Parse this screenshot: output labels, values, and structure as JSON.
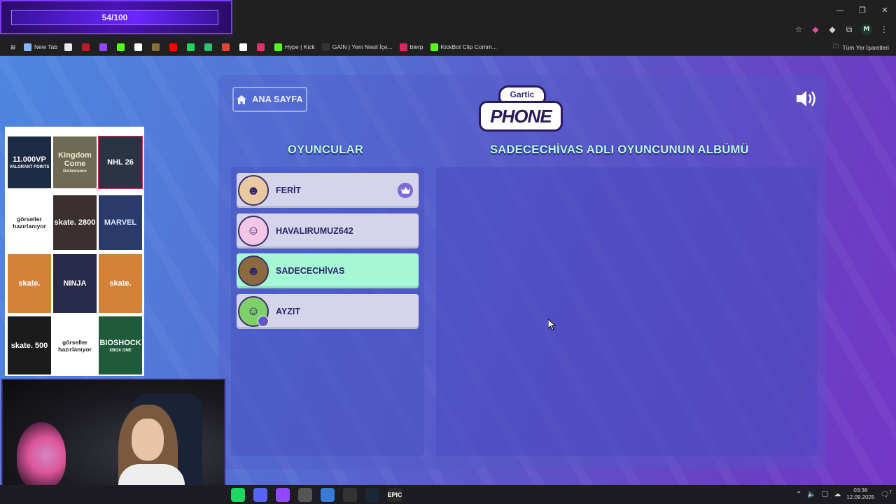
{
  "overlay": {
    "hype_progress": "54/100",
    "hype_fraction": 0.54
  },
  "browser": {
    "window_controls": [
      "—",
      "❐",
      "✕"
    ],
    "profile_initial": "M",
    "bookmarks": [
      {
        "label": "New Tab",
        "icon": "globe-icon",
        "color": "#8ab4f8"
      },
      {
        "label": "",
        "icon": "doc-icon",
        "color": "#e8eaed"
      },
      {
        "label": "",
        "icon": "red-icon",
        "color": "#c0182a"
      },
      {
        "label": "",
        "icon": "twitch-icon",
        "color": "#9146ff"
      },
      {
        "label": "",
        "icon": "kick-icon",
        "color": "#53fc18"
      },
      {
        "label": "",
        "icon": "diamond-icon",
        "color": "#ffffff"
      },
      {
        "label": "",
        "icon": "game-icon",
        "color": "#8a6d3b"
      },
      {
        "label": "",
        "icon": "youtube-icon",
        "color": "#ff0000"
      },
      {
        "label": "",
        "icon": "spotify-icon",
        "color": "#1ed760"
      },
      {
        "label": "",
        "icon": "green-icon",
        "color": "#2fbf71"
      },
      {
        "label": "",
        "icon": "gmail-icon",
        "color": "#ea4335"
      },
      {
        "label": "",
        "icon": "x-icon",
        "color": "#ffffff"
      },
      {
        "label": "",
        "icon": "instagram-icon",
        "color": "#e1306c"
      },
      {
        "label": "Hype | Kick",
        "icon": "kick-icon",
        "color": "#53fc18"
      },
      {
        "label": "GAİN | Yeni Nesil İçe...",
        "icon": "gain-icon",
        "color": "#333333"
      },
      {
        "label": "blerp",
        "icon": "blerp-icon",
        "color": "#e0245e"
      },
      {
        "label": "KickBot Clip Comm...",
        "icon": "kickbot-icon",
        "color": "#53fc18"
      }
    ],
    "all_bookmarks_label": "Tüm Yer İşaretleri"
  },
  "game": {
    "home_label": "ANA SAYFA",
    "logo_top": "Gartic",
    "logo_main": "PHONE",
    "players_title": "OYUNCULAR",
    "album_title": "SADECECHİVAS ADLI OYUNCUNUN ALBÜMÜ",
    "players": [
      {
        "name": "FERİT",
        "avatar_color": "#e9c9a0",
        "emoji": "☻",
        "host": true,
        "active": false,
        "badge": false
      },
      {
        "name": "HAVALIRUMUZ642",
        "avatar_color": "#f3c6e6",
        "emoji": "☺",
        "host": false,
        "active": false,
        "badge": false
      },
      {
        "name": "SADECECHİVAS",
        "avatar_color": "#8a6a3e",
        "emoji": "☻",
        "host": false,
        "active": true,
        "badge": false
      },
      {
        "name": "AYZIT",
        "avatar_color": "#7fd06a",
        "emoji": "☺",
        "host": false,
        "active": false,
        "badge": true
      }
    ]
  },
  "ads": {
    "tiles": [
      {
        "text": "11.000VP",
        "sub": "VALORANT POINTS",
        "bg": "#1d2b44",
        "fg": "#ffffff"
      },
      {
        "text": "Kingdom Come",
        "sub": "Deliverance",
        "bg": "#6d6a55",
        "fg": "#f3ead0"
      },
      {
        "text": "NHL 26",
        "sub": "",
        "bg": "#2b3344",
        "fg": "#ffffff"
      },
      {
        "text": "görseller hazırlanıyor",
        "sub": "",
        "bg": "#ffffff",
        "fg": "#222222"
      },
      {
        "text": "skate. 2800",
        "sub": "",
        "bg": "#3a3030",
        "fg": "#ffffff"
      },
      {
        "text": "MARVEL",
        "sub": "",
        "bg": "#2a3a6a",
        "fg": "#dfe7ff"
      },
      {
        "text": "skate.",
        "sub": "",
        "bg": "#d4823a",
        "fg": "#ffffff"
      },
      {
        "text": "NINJA",
        "sub": "",
        "bg": "#2a2a4a",
        "fg": "#ffffff"
      },
      {
        "text": "skate.",
        "sub": "",
        "bg": "#d4823a",
        "fg": "#ffffff"
      },
      {
        "text": "skate. 500",
        "sub": "",
        "bg": "#1a1a1a",
        "fg": "#ffffff"
      },
      {
        "text": "görseller hazırlanıyor",
        "sub": "",
        "bg": "#ffffff",
        "fg": "#222222"
      },
      {
        "text": "BIOSHOCK",
        "sub": "XBOX ONE",
        "bg": "#1f5a3a",
        "fg": "#ffffff"
      }
    ]
  },
  "taskbar": {
    "apps": [
      {
        "icon": "spotify-icon",
        "color": "#1ed760",
        "label": ""
      },
      {
        "icon": "discord-icon",
        "color": "#5865f2",
        "label": ""
      },
      {
        "icon": "twitch-icon",
        "color": "#9146ff",
        "label": ""
      },
      {
        "icon": "controller-icon",
        "color": "#555555",
        "label": ""
      },
      {
        "icon": "screen-icon",
        "color": "#3a7bd5",
        "label": ""
      },
      {
        "icon": "obs-icon",
        "color": "#333333",
        "label": ""
      },
      {
        "icon": "steam-icon",
        "color": "#1b2838",
        "label": ""
      },
      {
        "icon": "epic-icon",
        "color": "#2a2a2a",
        "label": "EPIC"
      }
    ],
    "time": "03:36",
    "date": "12.09.2025",
    "notification_count": "7"
  }
}
